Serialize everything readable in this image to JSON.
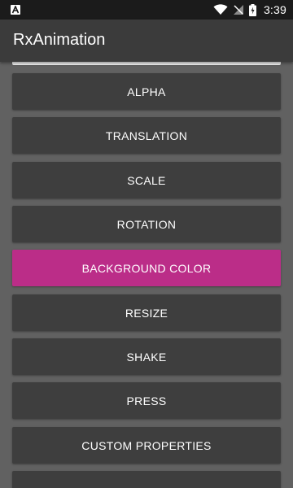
{
  "status_bar": {
    "time": "3:39",
    "icons": [
      "a-notification-icon",
      "wifi-icon",
      "no-signal-icon",
      "battery-charging-icon"
    ]
  },
  "app": {
    "title": "RxAnimation"
  },
  "buttons": [
    {
      "label": "ALPHA"
    },
    {
      "label": "TRANSLATION"
    },
    {
      "label": "SCALE"
    },
    {
      "label": "ROTATION"
    },
    {
      "label": "BACKGROUND COLOR",
      "highlight_color": "#bb2d88"
    },
    {
      "label": "RESIZE"
    },
    {
      "label": "SHAKE"
    },
    {
      "label": "PRESS"
    },
    {
      "label": "CUSTOM PROPERTIES"
    },
    {
      "label": ""
    }
  ],
  "colors": {
    "status_bar": "#1b1b1b",
    "app_bar": "#3b3b3b",
    "background": "#616161",
    "button": "#3e3e3e",
    "accent": "#bb2d88"
  }
}
